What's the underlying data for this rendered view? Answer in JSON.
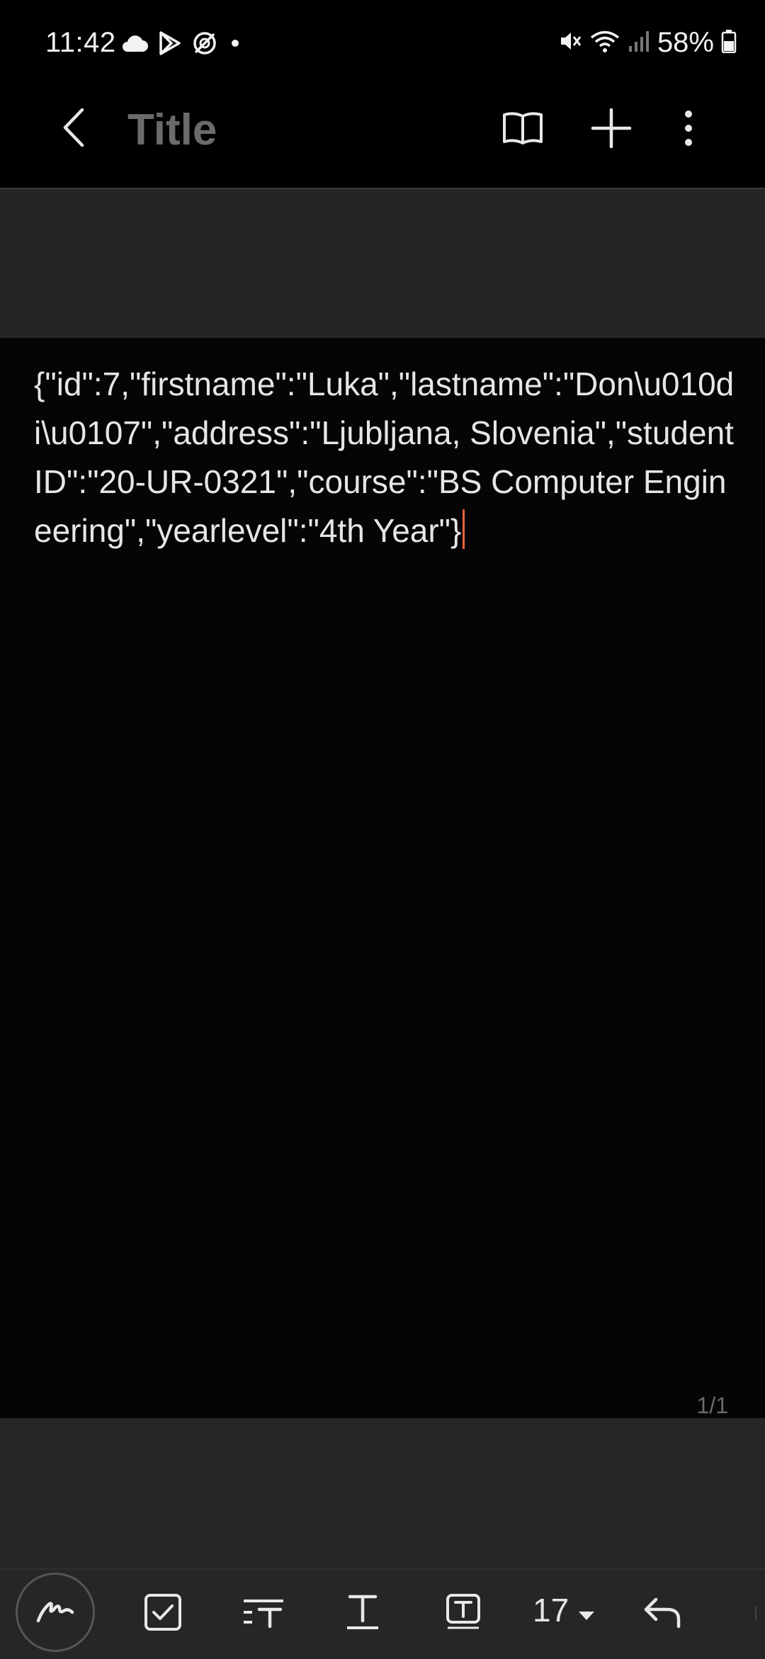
{
  "status_bar": {
    "time": "11:42",
    "battery_percent": "58%",
    "icons_left": [
      "cloud-icon",
      "play-store-icon",
      "sync-icon",
      "dot-icon"
    ],
    "icons_right": [
      "mute-icon",
      "wifi-icon",
      "signal-icon",
      "battery-icon"
    ]
  },
  "header": {
    "title_placeholder": "Title",
    "back_icon": "chevron-left-icon",
    "reader_icon": "book-icon",
    "add_icon": "plus-icon",
    "more_icon": "more-vertical-icon"
  },
  "note": {
    "content": "{\"id\":7,\"firstname\":\"Luka\",\"lastname\":\"Don\\u010di\\u0107\",\"address\":\"Ljubljana, Slovenia\",\"studentID\":\"20-UR-0321\",\"course\":\"BS Computer Engineering\",\"yearlevel\":\"4th Year\"}",
    "page_indicator": "1/1"
  },
  "toolbar": {
    "font_size": "17",
    "tools": [
      "pen-icon",
      "checkbox-icon",
      "text-style-icon",
      "text-underline-icon",
      "text-box-icon",
      "font-size-dropdown",
      "undo-icon"
    ]
  },
  "colors": {
    "background": "#000000",
    "header_band": "#252525",
    "bottom_area": "#262626",
    "cursor": "#f0623a",
    "title_placeholder": "#6b6b6b"
  }
}
